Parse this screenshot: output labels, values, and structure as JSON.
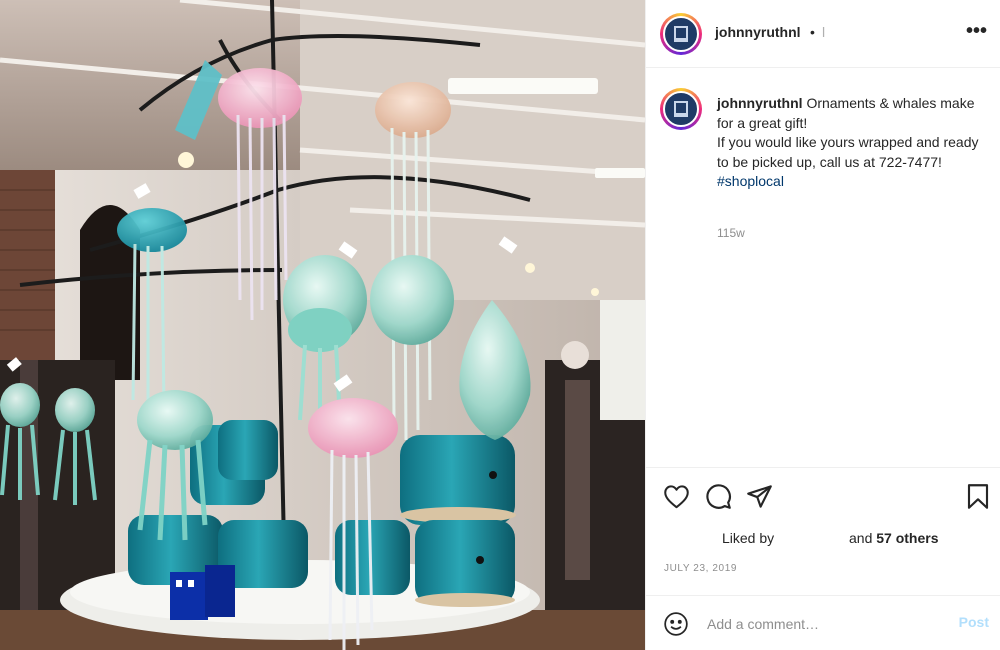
{
  "post": {
    "username": "johnnyruthnl",
    "follow_separator": "•",
    "follow_label": "l",
    "more_icon": "more-horizontal-icon",
    "caption": {
      "username": "johnnyruthnl",
      "line1": "Ornaments & whales make for a great gift!",
      "line2": "If you would like yours wrapped and ready to be picked up, call us at 722-7477!",
      "hashtag": "#shoplocal"
    },
    "age": "115w",
    "likes": {
      "prefix": "Liked by",
      "suffix_pre": "and",
      "others": "57 others"
    },
    "date": "JULY 23, 2019",
    "comment": {
      "placeholder": "Add a comment…",
      "post_label": "Post"
    },
    "icons": {
      "like": "heart-icon",
      "comment": "comment-icon",
      "share": "paper-plane-icon",
      "save": "bookmark-icon",
      "emoji": "smiley-icon"
    },
    "colors": {
      "link": "#00376b",
      "muted": "#8e8e8e",
      "post_disabled": "#b2dffc",
      "avatar_bg": "#1f3b66"
    }
  }
}
